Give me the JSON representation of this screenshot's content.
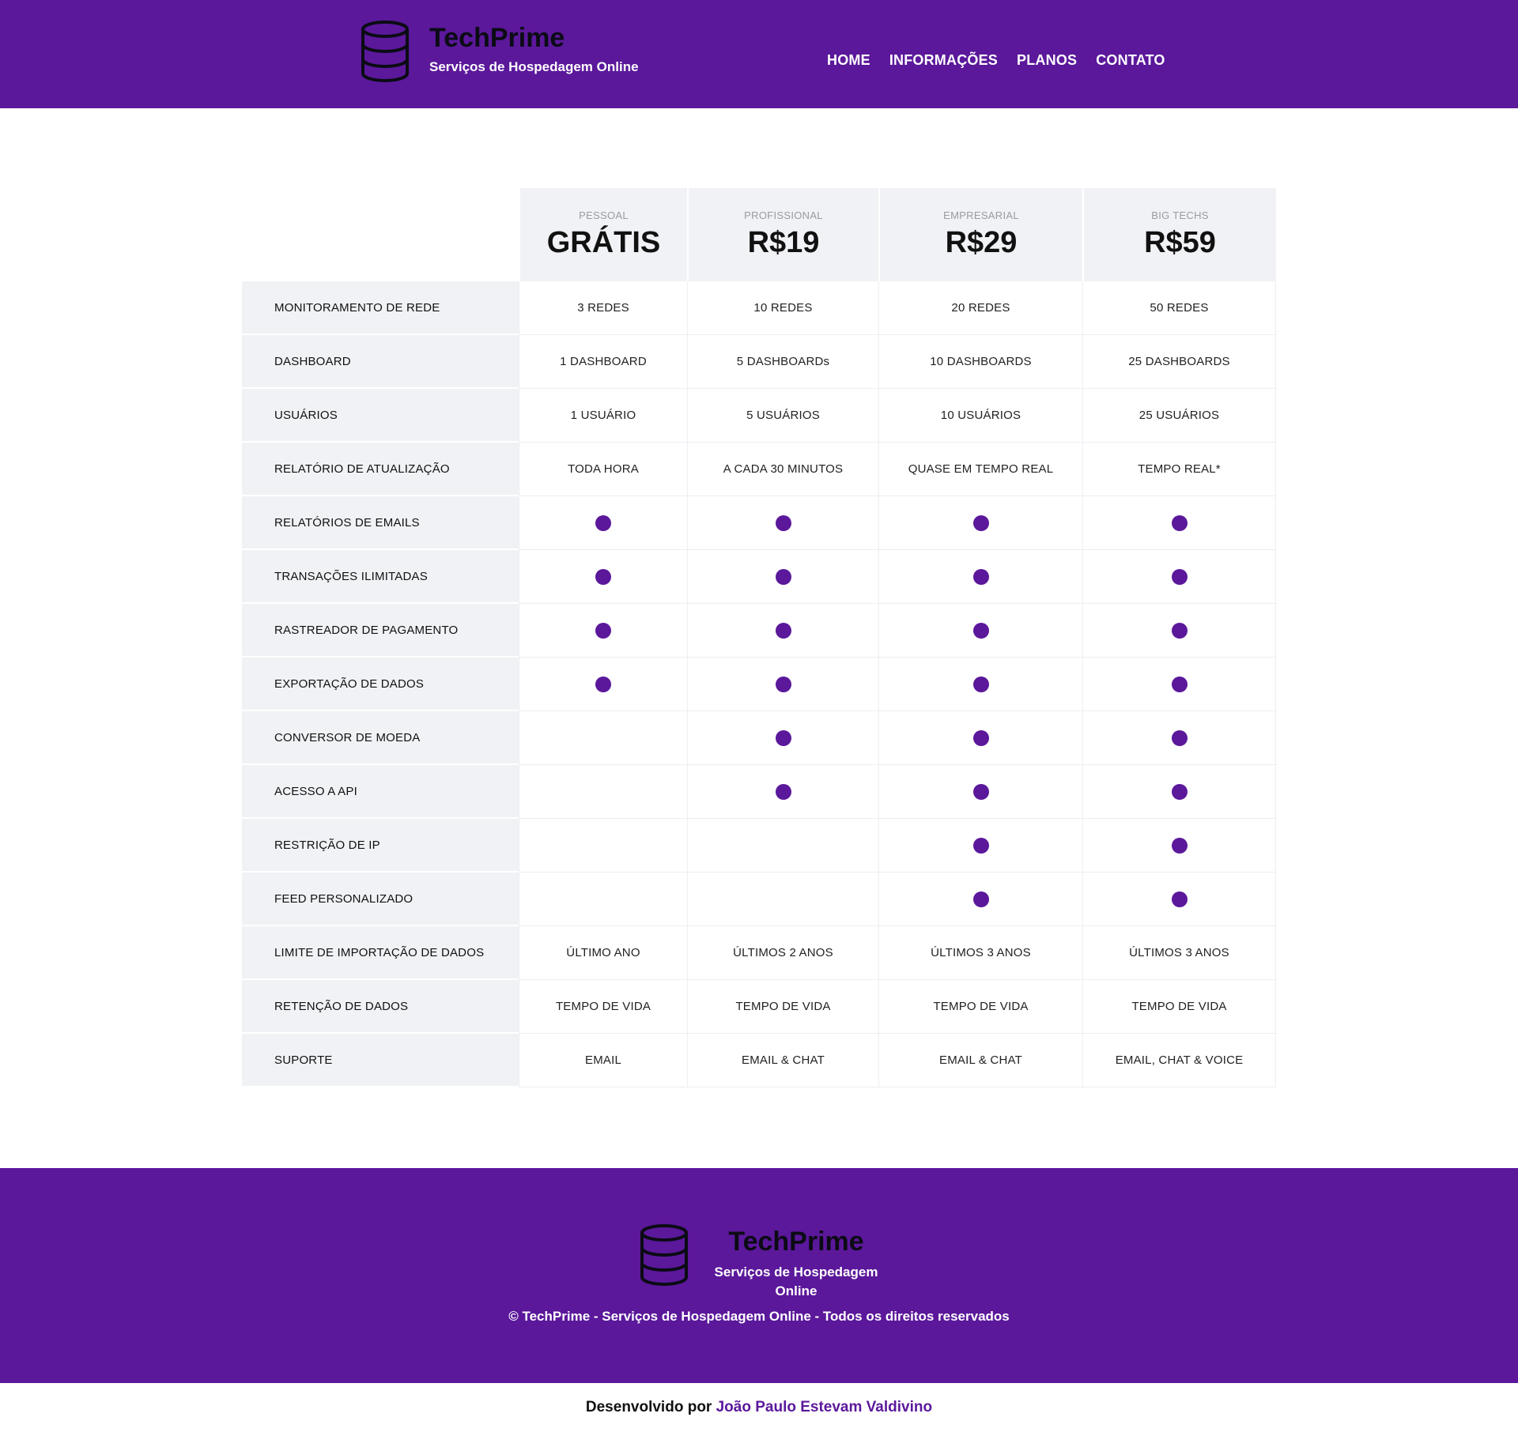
{
  "brand": {
    "title": "TechPrime",
    "subtitle": "Serviços de Hospedagem Online",
    "icon": "database-icon"
  },
  "nav": {
    "items": [
      {
        "label": "HOME"
      },
      {
        "label": "INFORMAÇÕES"
      },
      {
        "label": "PLANOS"
      },
      {
        "label": "CONTATO"
      }
    ]
  },
  "plans": [
    {
      "name": "PESSOAL",
      "price": "GRÁTIS"
    },
    {
      "name": "PROFISSIONAL",
      "price": "R$19"
    },
    {
      "name": "EMPRESARIAL",
      "price": "R$29"
    },
    {
      "name": "BIG TECHS",
      "price": "R$59"
    }
  ],
  "features": [
    {
      "name": "MONITORAMENTO DE REDE",
      "values": [
        "3 REDES",
        "10 REDES",
        "20 REDES",
        "50 REDES"
      ]
    },
    {
      "name": "DASHBOARD",
      "values": [
        "1 DASHBOARD",
        "5 DASHBOARDs",
        "10 DASHBOARDS",
        "25 DASHBOARDS"
      ]
    },
    {
      "name": "USUÁRIOS",
      "values": [
        "1 USUÁRIO",
        "5 USUÁRIOS",
        "10 USUÁRIOS",
        "25 USUÁRIOS"
      ]
    },
    {
      "name": "RELATÓRIO DE ATUALIZAÇÃO",
      "values": [
        "TODA HORA",
        "A CADA 30 MINUTOS",
        "QUASE EM TEMPO REAL",
        "TEMPO REAL*"
      ]
    },
    {
      "name": "RELATÓRIOS DE EMAILS",
      "values": [
        true,
        true,
        true,
        true
      ]
    },
    {
      "name": "TRANSAÇÕES ILIMITADAS",
      "values": [
        true,
        true,
        true,
        true
      ]
    },
    {
      "name": "RASTREADOR DE PAGAMENTO",
      "values": [
        true,
        true,
        true,
        true
      ]
    },
    {
      "name": "EXPORTAÇÃO DE DADOS",
      "values": [
        true,
        true,
        true,
        true
      ]
    },
    {
      "name": "CONVERSOR DE MOEDA",
      "values": [
        false,
        true,
        true,
        true
      ]
    },
    {
      "name": "ACESSO A API",
      "values": [
        false,
        true,
        true,
        true
      ]
    },
    {
      "name": "RESTRIÇÃO DE IP",
      "values": [
        false,
        false,
        true,
        true
      ]
    },
    {
      "name": "FEED PERSONALIZADO",
      "values": [
        false,
        false,
        true,
        true
      ]
    },
    {
      "name": "LIMITE DE IMPORTAÇÃO DE DADOS",
      "values": [
        "ÚLTIMO ANO",
        "ÚLTIMOS 2 ANOS",
        "ÚLTIMOS 3 ANOS",
        "ÚLTIMOS 3 ANOS"
      ]
    },
    {
      "name": "RETENÇÃO DE DADOS",
      "values": [
        "TEMPO DE VIDA",
        "TEMPO DE VIDA",
        "TEMPO DE VIDA",
        "TEMPO DE VIDA"
      ]
    },
    {
      "name": "SUPORTE",
      "values": [
        "EMAIL",
        "EMAIL & CHAT",
        "EMAIL & CHAT",
        "EMAIL, CHAT & VOICE"
      ]
    }
  ],
  "footer": {
    "title": "TechPrime",
    "subtitle": "Serviços de Hospedagem Online",
    "copyright": "© TechPrime - Serviços de Hospedagem Online - Todos os direitos reservados"
  },
  "credit": {
    "prefix": "Desenvolvido por",
    "author": "João Paulo Estevam Valdivino"
  },
  "colors": {
    "brand_purple": "#5b189b",
    "table_gray": "#f1f2f5"
  }
}
